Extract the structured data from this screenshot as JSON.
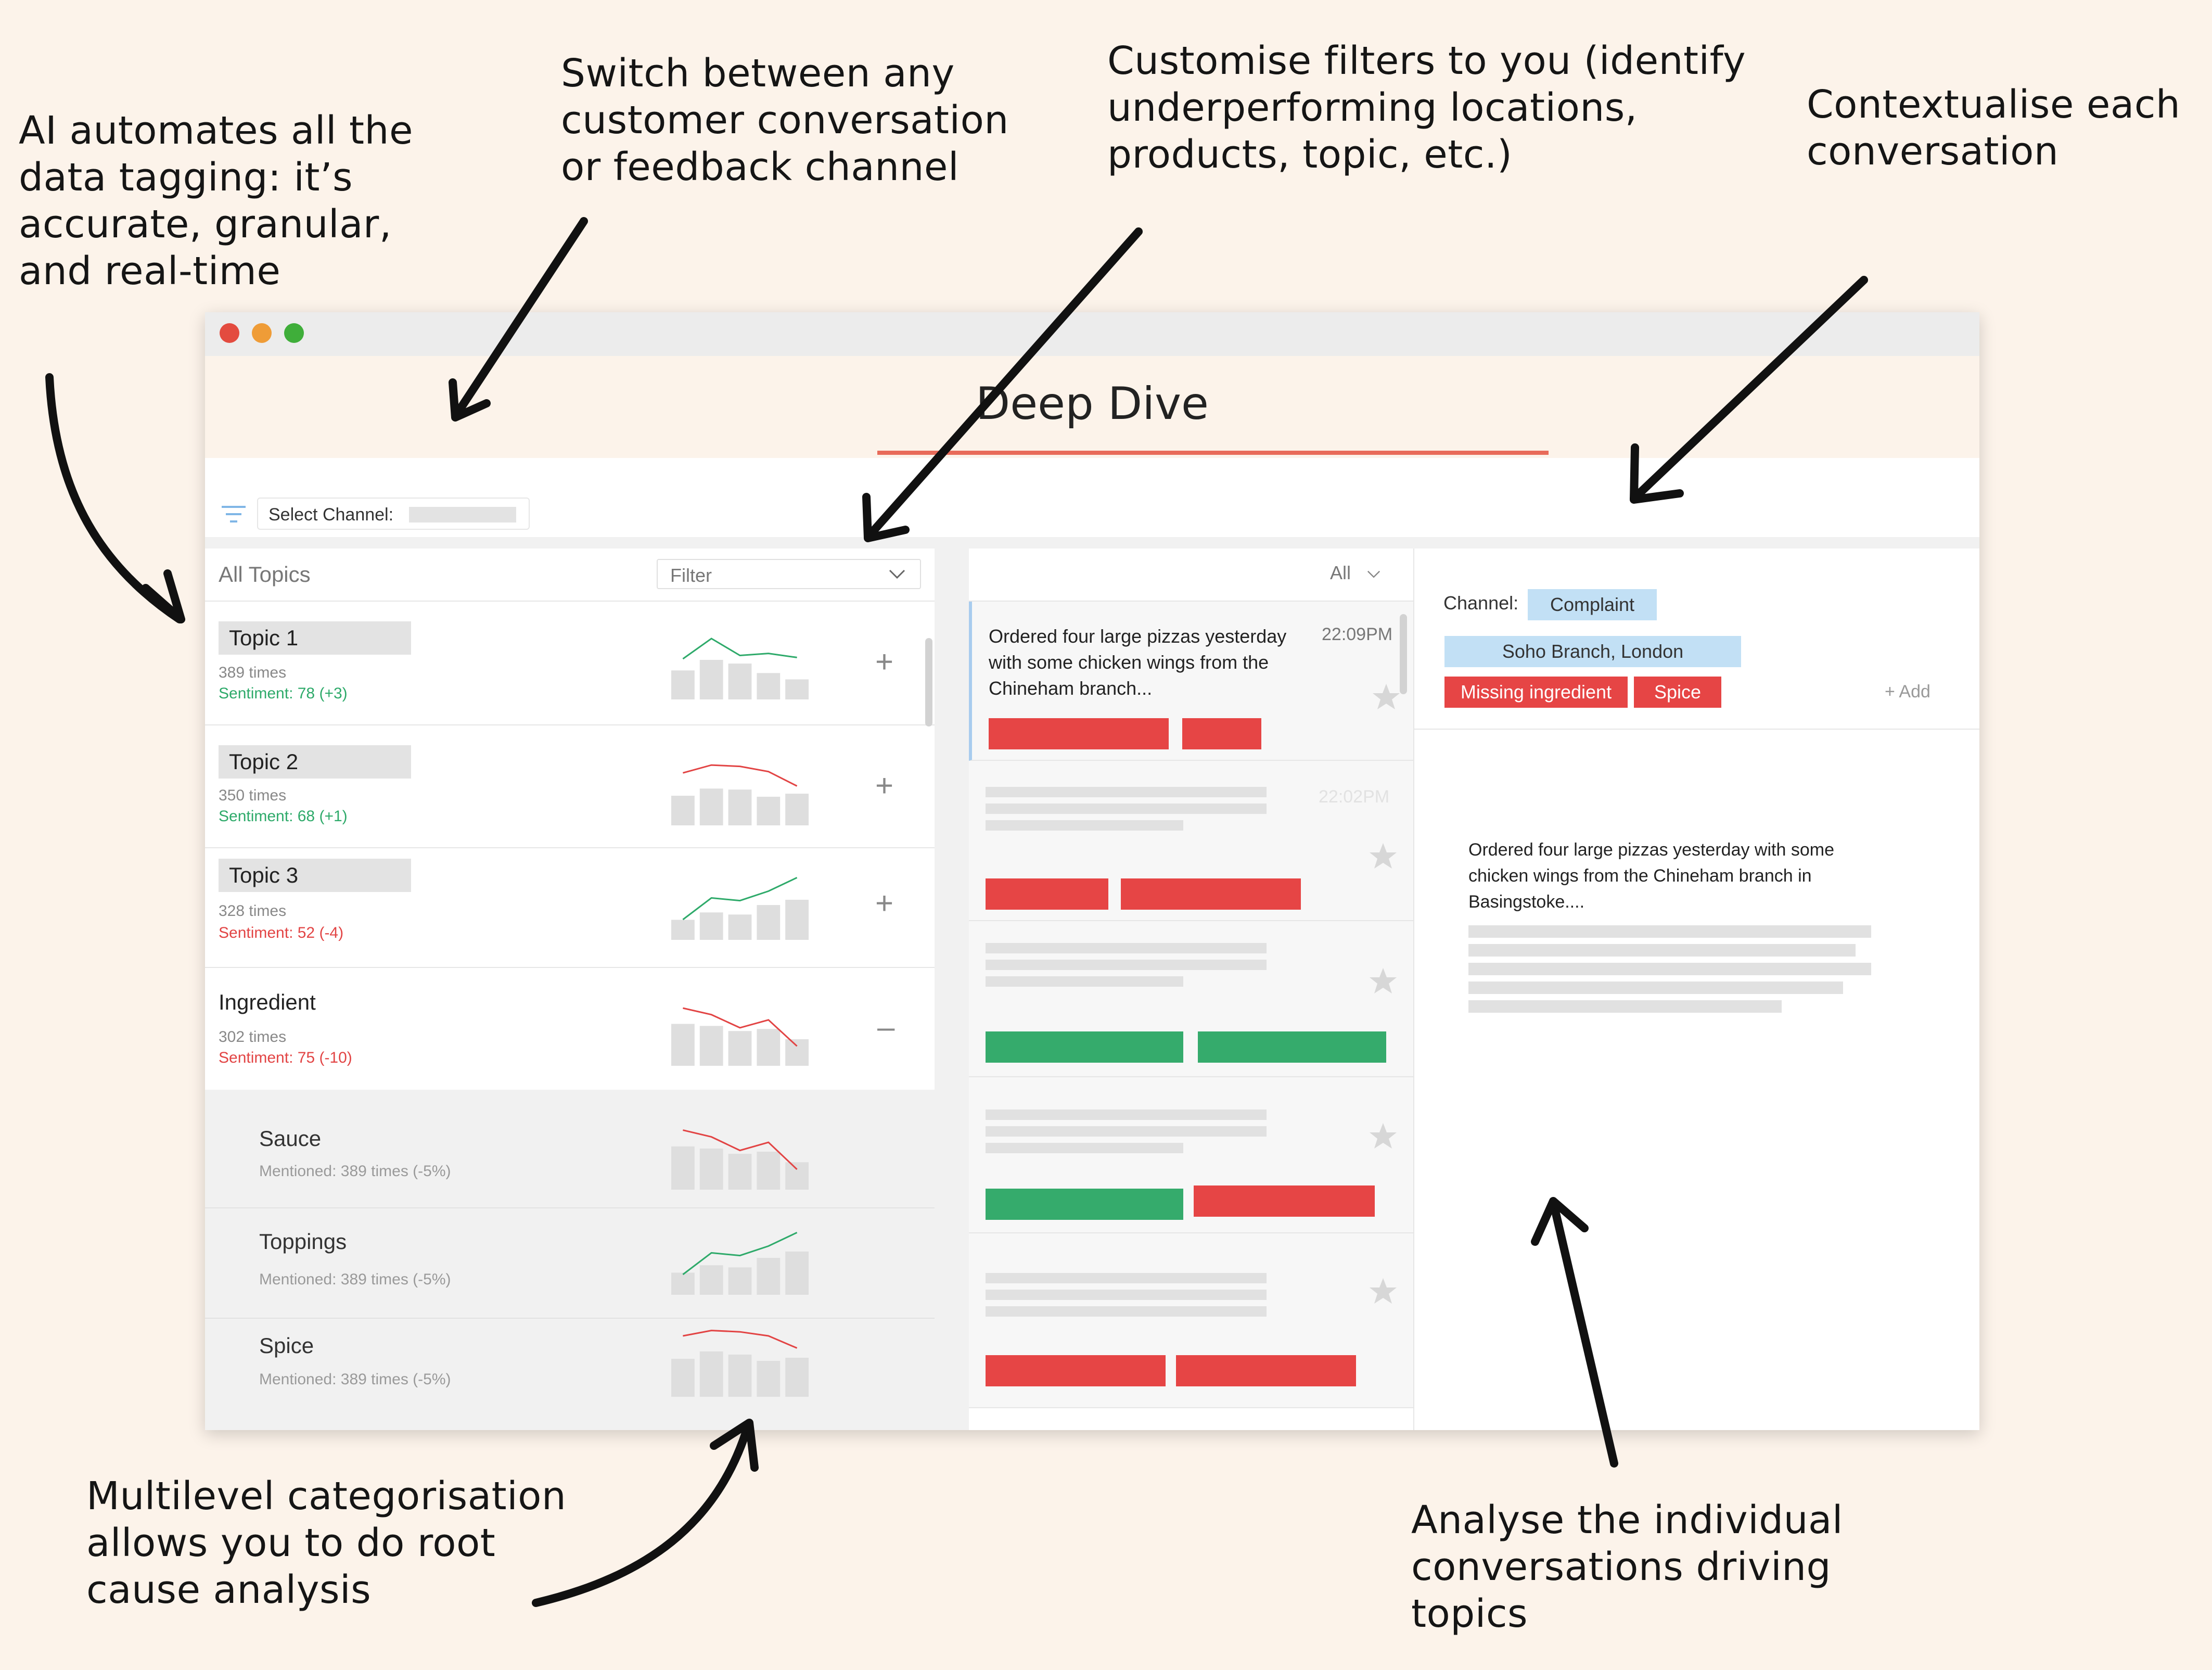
{
  "annotations": {
    "ai_tagging": [
      "AI automates all the",
      "data tagging: it’s",
      "accurate, granular,",
      "and real-time"
    ],
    "switch_channel": [
      "Switch between any",
      "customer conversation",
      "or feedback channel"
    ],
    "customise_filters": [
      "Customise filters to you (identify",
      "underperforming locations,",
      "products, topic, etc.)"
    ],
    "contextualise": [
      "Contextualise each",
      "conversation"
    ],
    "multilevel": [
      "Multilevel categorisation",
      "allows you to do root",
      "cause analysis"
    ],
    "analyse": [
      "Analyse the individual",
      "conversations driving",
      "topics"
    ]
  },
  "app": {
    "title": "Deep Dive",
    "channel_select_label": "Select Channel:"
  },
  "left_panel": {
    "header": "All Topics",
    "filter_label": "Filter",
    "topics": [
      {
        "name": "Topic 1",
        "count": "389 times",
        "sentiment": "Sentiment: 78 (+3)",
        "trend": "positive",
        "action": "+",
        "bars": [
          0.55,
          0.75,
          0.68,
          0.5,
          0.38
        ],
        "line": [
          0.6,
          0.9,
          0.65,
          0.68,
          0.62
        ]
      },
      {
        "name": "Topic 2",
        "count": "350 times",
        "sentiment": "Sentiment: 68 (+1)",
        "trend": "negative",
        "action": "+",
        "bars": [
          0.58,
          0.72,
          0.7,
          0.56,
          0.62
        ],
        "line": [
          0.8,
          0.92,
          0.9,
          0.82,
          0.6
        ]
      },
      {
        "name": "Topic 3",
        "count": "328 times",
        "sentiment": "Sentiment: 52 (-4)",
        "trend": "positive",
        "action": "+",
        "bars": [
          0.38,
          0.52,
          0.48,
          0.66,
          0.76
        ],
        "line": [
          0.3,
          0.62,
          0.58,
          0.72,
          0.92
        ]
      },
      {
        "name": "Ingredient",
        "count": "302 times",
        "sentiment": "Sentiment: 75 (-10)",
        "trend": "negative",
        "action": "–",
        "bars": [
          0.82,
          0.78,
          0.68,
          0.72,
          0.52
        ],
        "line": [
          0.88,
          0.78,
          0.58,
          0.7,
          0.3
        ]
      }
    ],
    "subtopics": [
      {
        "name": "Sauce",
        "meta": "Mentioned: 389 times (-5%)",
        "trend": "negative",
        "bars": [
          0.82,
          0.78,
          0.68,
          0.72,
          0.52
        ],
        "line": [
          0.88,
          0.78,
          0.58,
          0.7,
          0.3
        ]
      },
      {
        "name": "Toppings",
        "meta": "Mentioned: 389 times (-5%)",
        "trend": "positive",
        "bars": [
          0.42,
          0.56,
          0.52,
          0.7,
          0.82
        ],
        "line": [
          0.3,
          0.62,
          0.58,
          0.72,
          0.92
        ]
      },
      {
        "name": "Spice",
        "meta": "Mentioned: 389 times (-5%)",
        "trend": "negative",
        "bars": [
          0.72,
          0.86,
          0.8,
          0.68,
          0.74
        ],
        "line": [
          0.9,
          0.98,
          0.96,
          0.9,
          0.72
        ]
      }
    ]
  },
  "middle_panel": {
    "filter_label": "All",
    "conversations": [
      {
        "text": "Ordered four large pizzas yesterday with some chicken wings from the Chineham branch...",
        "time": "22:09PM",
        "tags": [
          "red",
          "red"
        ]
      },
      {
        "text": "",
        "time": "22:02PM",
        "tags": [
          "red",
          "red"
        ]
      },
      {
        "text": "",
        "time": "",
        "tags": [
          "green",
          "green"
        ]
      },
      {
        "text": "",
        "time": "",
        "tags": [
          "green",
          "red"
        ]
      },
      {
        "text": "",
        "time": "",
        "tags": [
          "red",
          "red"
        ]
      }
    ]
  },
  "right_panel": {
    "channel_label": "Channel:",
    "channel_value": "Complaint",
    "location": "Soho Branch, London",
    "tags": [
      "Missing ingredient",
      "Spice"
    ],
    "add_label": "+ Add",
    "message": "Ordered four large pizzas yesterday with some chicken wings from the Chineham branch in Basingstoke...."
  },
  "colors": {
    "background": "#fcf3ea",
    "positive": "#2eaa6a",
    "negative": "#e24444",
    "accent_underline": "#e86b5a",
    "tag_red": "#e64545",
    "tag_green": "#35ab6c",
    "tag_blue": "#c2e0f5"
  }
}
